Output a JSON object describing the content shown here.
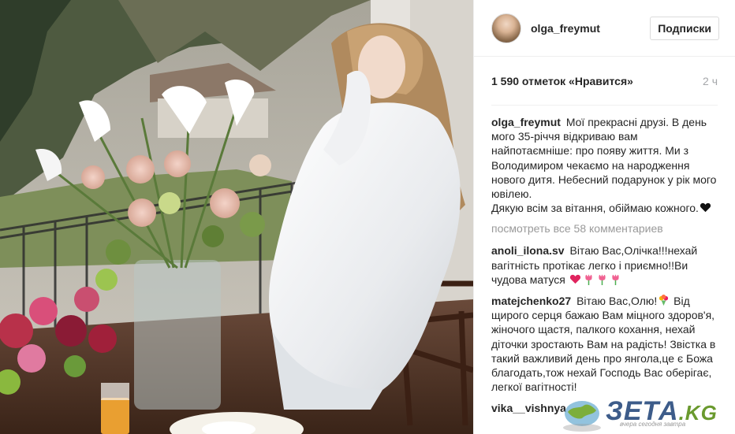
{
  "post": {
    "username": "olga_freymut",
    "follow_label": "Подписки",
    "likes": "1 590 отметок «Нравится»",
    "time": "2 ч",
    "caption_user": "olga_freymut",
    "caption_text": "Мої прекрасні друзі. В день мого 35-річчя відкриваю вам найпотаємніше: про появу життя. Ми з Володимиром чекаємо на народження нового дитя. Небесний подарунок у рік мого ювілею.",
    "caption_text_2": "Дякую всім за вітання, обіймаю кожного.",
    "view_all": "посмотреть все 58 комментариев"
  },
  "comments": [
    {
      "user": "anoli_ilona.sv",
      "text": "Вітаю Вас,Олічка!!!нехай вагітність протікає легко і приємно!!Ви чудова матуся"
    },
    {
      "user": "matejchenko27",
      "text_a": "Вітаю Вас,Олю!",
      "text_b": "Від щирого серця бажаю Вам міцного здоров'я, жіночого щастя, палкого кохання, нехай діточки зростають Вам на радість! Звістка в такий важливий день про янгола,це є Божа благодать,тож нехай Господь Вас оберігає, легкої вагітності!"
    },
    {
      "user": "vika__vishnya"
    }
  ],
  "watermark": {
    "brand": "ЗЕТА",
    "domain": ".KG",
    "tagline": "вчера сегодня завтра"
  },
  "icons": {
    "avatar": "avatar",
    "heart": "black-heart-emoji",
    "tulip": "tulip-emoji",
    "bouquet": "bouquet-emoji"
  },
  "colors": {
    "username": "#262626",
    "muted": "#999999",
    "timestamp": "#a5a7aa",
    "border": "#efefef",
    "heart_red": "#e0245e",
    "tulip_pink": "#f06292"
  }
}
